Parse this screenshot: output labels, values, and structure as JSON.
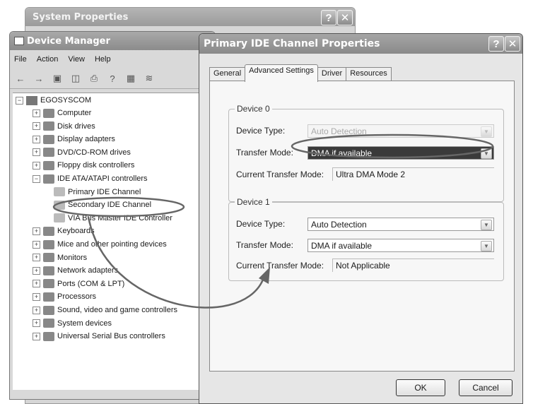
{
  "system_properties": {
    "title": "System Properties",
    "help": "?",
    "close": "✕"
  },
  "device_manager": {
    "title": "Device Manager",
    "menu": [
      "File",
      "Action",
      "View",
      "Help"
    ],
    "tree": {
      "root": "EGOSYSCOM",
      "items": [
        {
          "label": "Computer",
          "exp": "+"
        },
        {
          "label": "Disk drives",
          "exp": "+"
        },
        {
          "label": "Display adapters",
          "exp": "+"
        },
        {
          "label": "DVD/CD-ROM drives",
          "exp": "+"
        },
        {
          "label": "Floppy disk controllers",
          "exp": "+"
        },
        {
          "label": "IDE ATA/ATAPI controllers",
          "exp": "−"
        },
        {
          "label": "Primary IDE Channel",
          "child": true
        },
        {
          "label": "Secondary IDE Channel",
          "child": true
        },
        {
          "label": "VIA Bus Master IDE Controller",
          "child": true
        },
        {
          "label": "Keyboards",
          "exp": "+"
        },
        {
          "label": "Mice and other pointing devices",
          "exp": "+"
        },
        {
          "label": "Monitors",
          "exp": "+"
        },
        {
          "label": "Network adapters",
          "exp": "+"
        },
        {
          "label": "Ports (COM & LPT)",
          "exp": "+"
        },
        {
          "label": "Processors",
          "exp": "+"
        },
        {
          "label": "Sound, video and game controllers",
          "exp": "+"
        },
        {
          "label": "System devices",
          "exp": "+"
        },
        {
          "label": "Universal Serial Bus controllers",
          "exp": "+"
        }
      ]
    }
  },
  "ide_properties": {
    "title": "Primary IDE Channel Properties",
    "help": "?",
    "close": "✕",
    "tabs": [
      "General",
      "Advanced Settings",
      "Driver",
      "Resources"
    ],
    "device0": {
      "title": "Device 0",
      "type_label": "Device Type:",
      "type_value": "Auto Detection",
      "transfer_label": "Transfer Mode:",
      "transfer_value": "DMA if available",
      "current_label": "Current Transfer Mode:",
      "current_value": "Ultra DMA Mode 2"
    },
    "device1": {
      "title": "Device 1",
      "type_label": "Device Type:",
      "type_value": "Auto Detection",
      "transfer_label": "Transfer Mode:",
      "transfer_value": "DMA if available",
      "current_label": "Current Transfer Mode:",
      "current_value": "Not Applicable"
    },
    "ok": "OK",
    "cancel": "Cancel"
  },
  "colors": {
    "title_bar": "#9b9b9b",
    "highlight": "#3a3a3a",
    "annotation": "#666666"
  }
}
